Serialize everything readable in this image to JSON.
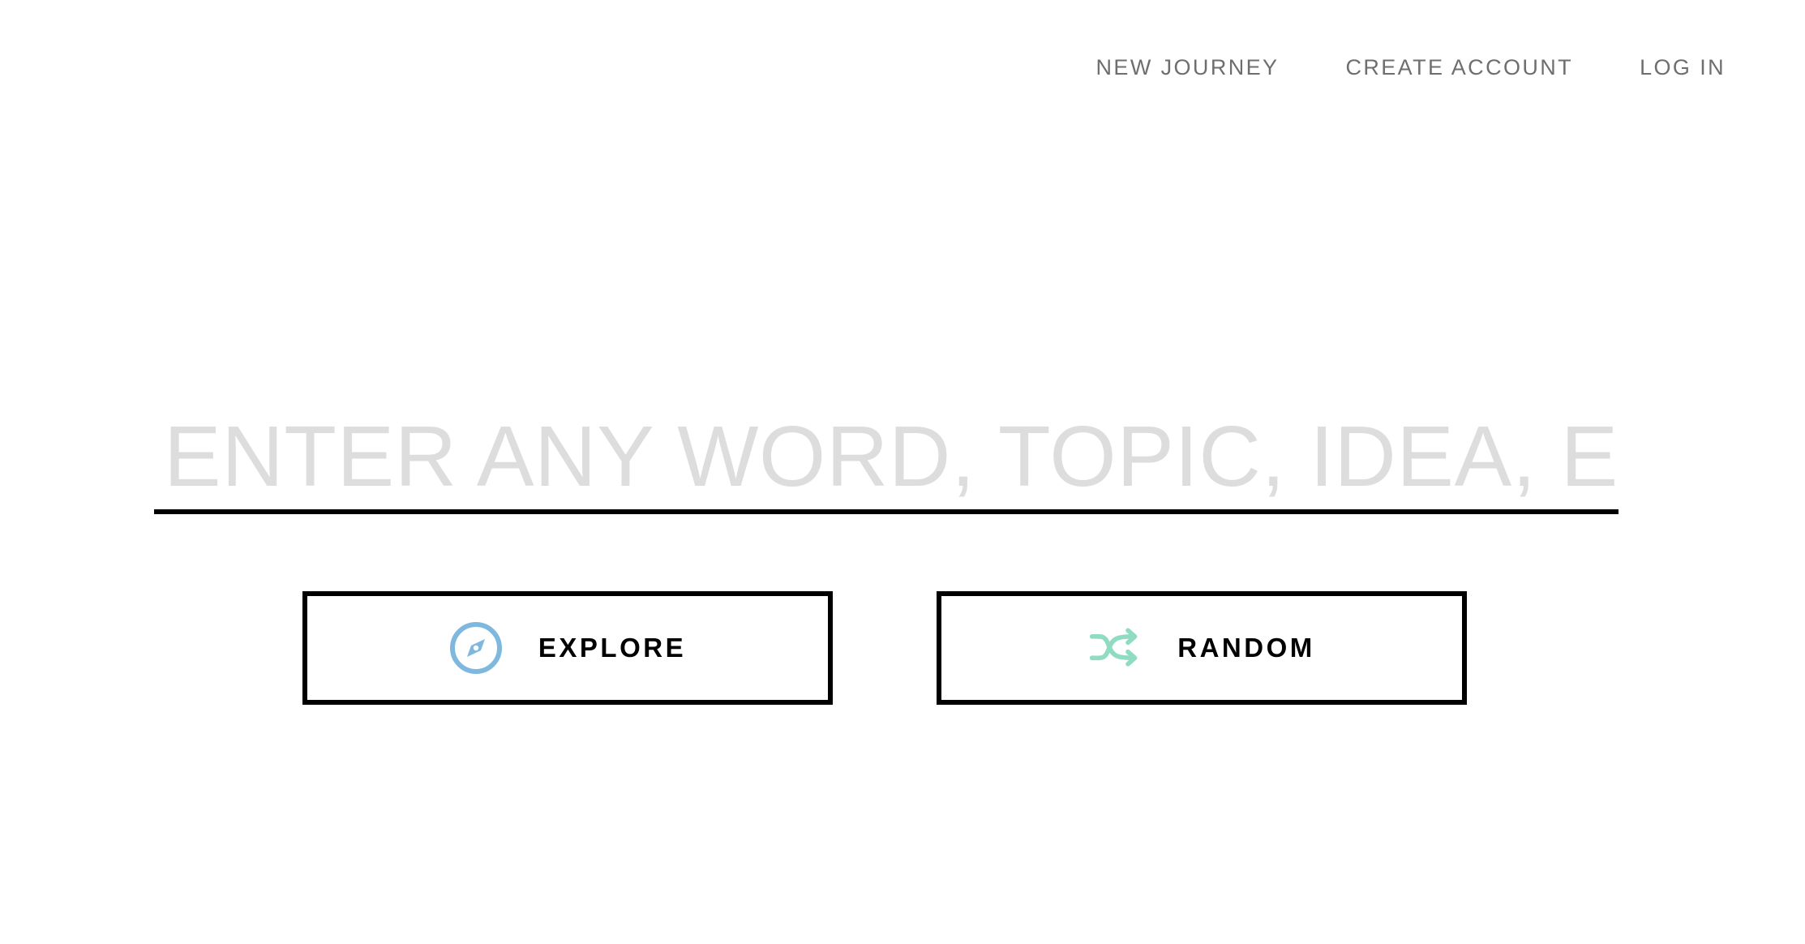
{
  "nav": {
    "items": [
      {
        "label": "NEW JOURNEY"
      },
      {
        "label": "CREATE ACCOUNT"
      },
      {
        "label": "LOG IN"
      }
    ]
  },
  "search": {
    "value": "",
    "placeholder": "ENTER ANY WORD, TOPIC, IDEA, ETC."
  },
  "buttons": {
    "explore": {
      "label": "EXPLORE",
      "icon": "compass-icon",
      "icon_color": "#7fb8de"
    },
    "random": {
      "label": "RANDOM",
      "icon": "shuffle-icon",
      "icon_color": "#8fdcc2"
    }
  }
}
